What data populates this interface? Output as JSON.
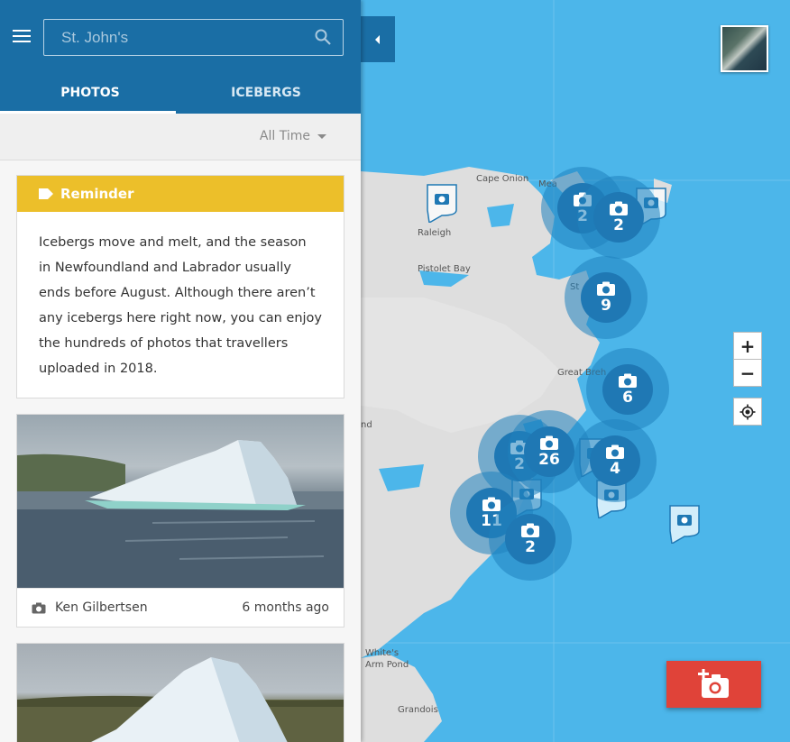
{
  "search": {
    "placeholder": "St. John's"
  },
  "tabs": {
    "photos": "PHOTOS",
    "icebergs": "ICEBERGS",
    "active": "PHOTOS"
  },
  "filter": {
    "selected": "All Time"
  },
  "reminder": {
    "title": "Reminder",
    "body": "Icebergs move and melt, and the season in Newfoundland and Labrador usually ends before August. Although there aren’t any icebergs here right now, you can enjoy the hundreds of photos that travellers uploaded in 2018."
  },
  "photos": [
    {
      "author": "Ken Gilbertsen",
      "time": "6 months ago"
    },
    {
      "author": "",
      "time": ""
    }
  ],
  "map": {
    "labels": {
      "cape_onion": "Cape Onion",
      "raleigh": "Raleigh",
      "pistolet_bay": "Pistolet Bay",
      "great_brehat": "Great Breh",
      "st_anthony": "St",
      "nd": "nd",
      "whites_arm_pond": "White's\nArm Pond",
      "grandois": "Grandois",
      "mea": "Mea"
    },
    "clusters": [
      "2",
      "2",
      "9",
      "6",
      "26",
      "2",
      "4",
      "11",
      "2"
    ],
    "controls": {
      "zoom_in": "+",
      "zoom_out": "−"
    }
  },
  "colors": {
    "header": "#1a6ea5",
    "reminder": "#ecbf2a",
    "cluster": "#1f78b4",
    "water": "#4cb6ea",
    "add_button": "#e04339"
  }
}
